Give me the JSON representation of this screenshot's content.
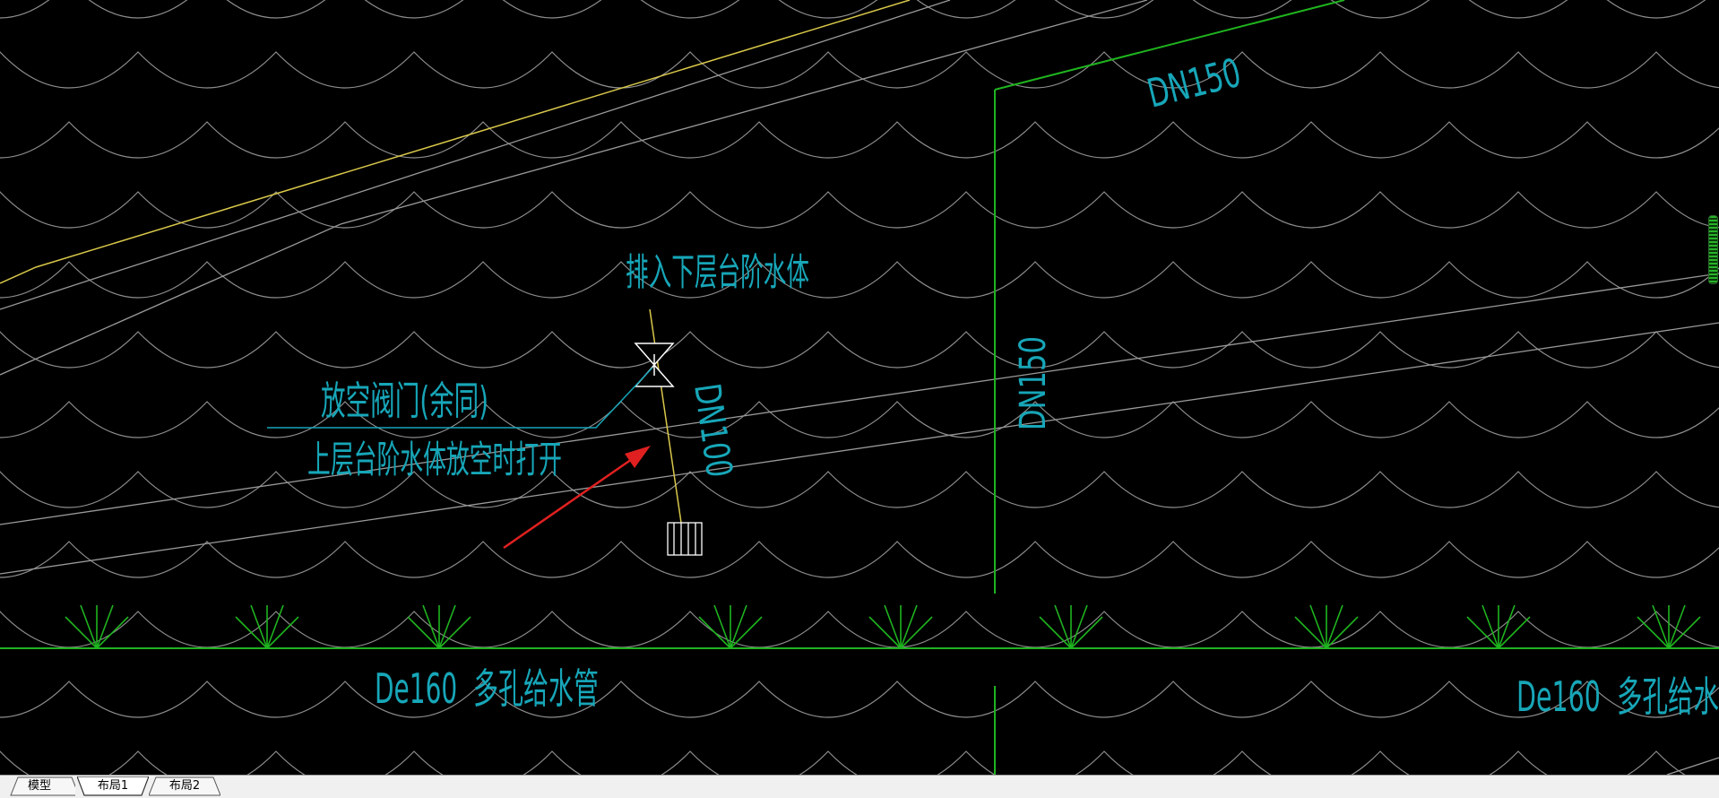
{
  "drawing": {
    "label_pipe_top": "DN150",
    "label_pipe_vertical": "DN150",
    "label_pipe_branch": "DN100",
    "label_discharge": "排入下层台阶水体",
    "label_valve_line1": "放空阀门(余同)",
    "label_valve_line2": "上层台阶水体放空时打开",
    "label_main_left": "De160  多孔给水管",
    "label_main_right": "De160  多孔给水"
  },
  "colors": {
    "background": "#000000",
    "cyan_text": "#17a6b8",
    "green_pipe": "#1fb41f",
    "yellow_line": "#d9c84a",
    "gray_line": "#9a9a9a",
    "arrow": "#e02020"
  },
  "tabs": [
    {
      "label": "模型",
      "active": false
    },
    {
      "label": "布局1",
      "active": true
    },
    {
      "label": "布局2",
      "active": false
    }
  ]
}
